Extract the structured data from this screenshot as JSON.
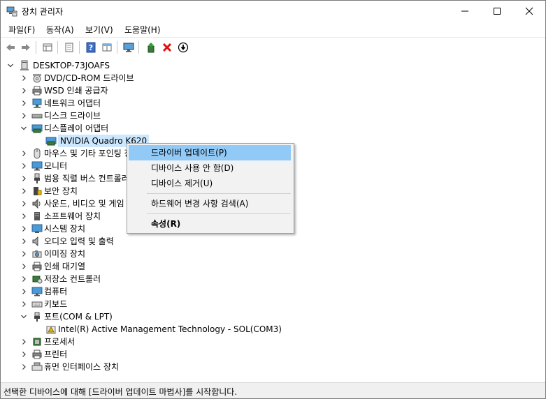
{
  "window": {
    "title": "장치 관리자"
  },
  "menu": [
    "파일(F)",
    "동작(A)",
    "보기(V)",
    "도움말(H)"
  ],
  "toolbar": {
    "buttons": [
      "back-icon",
      "forward-icon",
      "properties-grid-icon",
      "print-icon",
      "help-icon",
      "view-grid-icon",
      "monitor-icon",
      "update-driver-icon",
      "uninstall-icon",
      "disable-icon"
    ]
  },
  "tree": {
    "root": "DESKTOP-73JOAFS",
    "items": [
      {
        "label": "DVD/CD-ROM 드라이브",
        "icon": "dvd-icon"
      },
      {
        "label": "WSD 인쇄 공급자",
        "icon": "printer-icon"
      },
      {
        "label": "네트워크 어댑터",
        "icon": "network-icon"
      },
      {
        "label": "디스크 드라이브",
        "icon": "disk-icon"
      },
      {
        "label": "디스플레이 어댑터",
        "icon": "display-adapter-icon",
        "expanded": true
      },
      {
        "label": "NVIDIA Quadro K620",
        "icon": "display-adapter-icon",
        "child": true
      },
      {
        "label": "마우스 및 기타 포인팅 장치",
        "icon": "mouse-icon"
      },
      {
        "label": "모니터",
        "icon": "monitor-icon"
      },
      {
        "label": "범용 직렬 버스 컨트롤러",
        "icon": "usb-icon"
      },
      {
        "label": "보안 장치",
        "icon": "security-icon"
      },
      {
        "label": "사운드, 비디오 및 게임 컨트롤러",
        "icon": "sound-icon"
      },
      {
        "label": "소프트웨어 장치",
        "icon": "software-icon"
      },
      {
        "label": "시스템 장치",
        "icon": "system-icon"
      },
      {
        "label": "오디오 입력 및 출력",
        "icon": "audio-icon"
      },
      {
        "label": "이미징 장치",
        "icon": "camera-icon"
      },
      {
        "label": "인쇄 대기열",
        "icon": "printer-icon"
      },
      {
        "label": "저장소 컨트롤러",
        "icon": "storage-icon"
      },
      {
        "label": "컴퓨터",
        "icon": "computer-icon"
      },
      {
        "label": "키보드",
        "icon": "keyboard-icon"
      },
      {
        "label": "포트(COM & LPT)",
        "icon": "port-icon",
        "expanded": true
      },
      {
        "label": "Intel(R) Active Management Technology - SOL(COM3)",
        "icon": "port-child-icon",
        "child": true
      },
      {
        "label": "프로세서",
        "icon": "processor-icon"
      },
      {
        "label": "프린터",
        "icon": "printer-icon"
      },
      {
        "label": "휴먼 인터페이스 장치",
        "icon": "hid-icon"
      }
    ]
  },
  "context_menu": {
    "items": [
      "드라이버 업데이트(P)",
      "디바이스 사용 안 함(D)",
      "디바이스 제거(U)",
      "하드웨어 변경 사항 검색(A)",
      "속성(R)"
    ]
  },
  "status": "선택한 디바이스에 대해 [드라이버 업데이트 마법사]를 시작합니다.",
  "colors": {
    "selection": "#cce8ff",
    "menu_highlight": "#91c9f7",
    "accent": "#0078d7"
  }
}
